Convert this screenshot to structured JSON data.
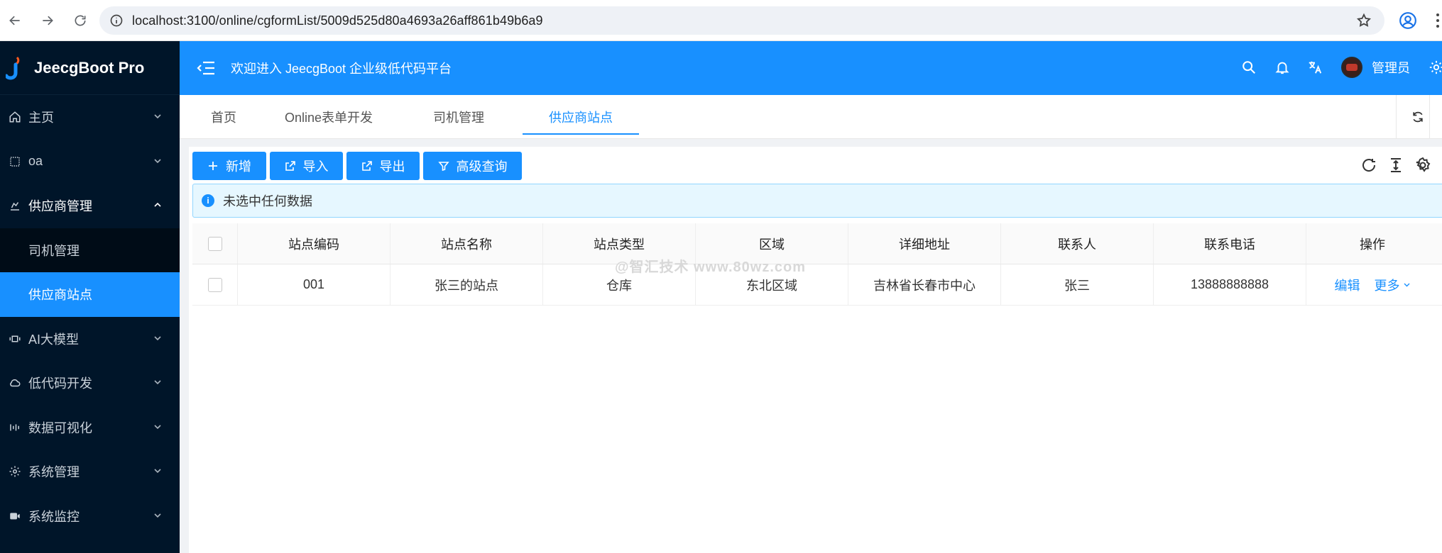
{
  "browser": {
    "url": "localhost:3100/online/cgformList/5009d525d80a4693a26aff861b49b6a9"
  },
  "sidebar": {
    "app_name": "JeecgBoot Pro",
    "items": [
      {
        "label": "主页",
        "icon": "home-icon"
      },
      {
        "label": "oa",
        "icon": "grid-icon"
      },
      {
        "label": "供应商管理",
        "icon": "supplier-icon"
      },
      {
        "label": "AI大模型",
        "icon": "ai-icon"
      },
      {
        "label": "低代码开发",
        "icon": "cloud-icon"
      },
      {
        "label": "数据可视化",
        "icon": "chart-icon"
      },
      {
        "label": "系统管理",
        "icon": "gear-icon"
      },
      {
        "label": "系统监控",
        "icon": "monitor-icon"
      }
    ],
    "submenu": [
      {
        "label": "司机管理"
      },
      {
        "label": "供应商站点"
      }
    ]
  },
  "header": {
    "welcome": "欢迎进入 JeecgBoot 企业级低代码平台",
    "user_name": "管理员"
  },
  "tabs": [
    {
      "label": "首页"
    },
    {
      "label": "Online表单开发"
    },
    {
      "label": "司机管理"
    },
    {
      "label": "供应商站点"
    }
  ],
  "toolbar": {
    "add": "新增",
    "import": "导入",
    "export": "导出",
    "advanced_query": "高级查询"
  },
  "alert": {
    "text": "未选中任何数据"
  },
  "table": {
    "columns": [
      "站点编码",
      "站点名称",
      "站点类型",
      "区域",
      "详细地址",
      "联系人",
      "联系电话",
      "操作"
    ],
    "rows": [
      {
        "code": "001",
        "name": "张三的站点",
        "type": "仓库",
        "region": "东北区域",
        "address": "吉林省长春市中心",
        "contact": "张三",
        "phone": "13888888888"
      }
    ],
    "actions": {
      "edit": "编辑",
      "more": "更多"
    }
  },
  "watermark": "@智汇技术 www.80wz.com",
  "colors": {
    "primary": "#1890ff",
    "sidebar_bg": "#001529"
  }
}
